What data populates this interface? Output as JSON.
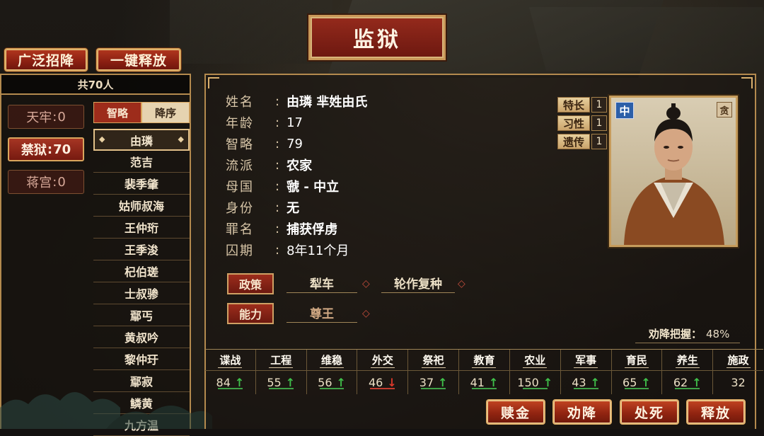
{
  "title": "监狱",
  "top_buttons": {
    "recruit_all": "广泛招降",
    "release_all": "一键释放"
  },
  "total_label": "共70人",
  "prisons": [
    {
      "label": "天牢",
      "count": "0"
    },
    {
      "label": "禁狱",
      "count": "70",
      "active": true
    },
    {
      "label": "蒋宫",
      "count": "0"
    }
  ],
  "sort": {
    "field": "智略",
    "order": "降序"
  },
  "prisoners": [
    "由璘",
    "范吉",
    "裴季肇",
    "姑师叔海",
    "王仲珩",
    "王季浚",
    "杞伯瑳",
    "士叔骖",
    "鄢丐",
    "黄叔吟",
    "黎仲玗",
    "鄢寂",
    "鳞黄",
    "九方温"
  ],
  "info": {
    "name_key": "姓名",
    "name_val": "由璘 芈姓由氏",
    "age_key": "年龄",
    "age_val": "17",
    "intel_key": "智略",
    "intel_val": "79",
    "school_key": "流派",
    "school_val": "农家",
    "home_key": "母国",
    "home_val": "虢 - 中立",
    "status_key": "身份",
    "status_val": "无",
    "crime_key": "罪名",
    "crime_val": "捕获俘虏",
    "term_key": "囚期",
    "term_val": "8年11个月"
  },
  "traits": [
    {
      "label": "特长",
      "value": "1"
    },
    {
      "label": "习性",
      "value": "1"
    },
    {
      "label": "遗传",
      "value": "1"
    }
  ],
  "portrait_badges": {
    "faction": "中",
    "trait": "贪"
  },
  "policy": {
    "label": "政策",
    "slot1": "犁车",
    "slot2": "轮作复种"
  },
  "ability": {
    "label": "能力",
    "slot1": "尊王"
  },
  "persuade": {
    "label": "劝降把握：",
    "value": "48%"
  },
  "skills": [
    {
      "name": "谍战",
      "value": "84",
      "trend": "up",
      "arrow": "↑"
    },
    {
      "name": "工程",
      "value": "55",
      "trend": "up",
      "arrow": "↑"
    },
    {
      "name": "维稳",
      "value": "56",
      "trend": "up",
      "arrow": "↑"
    },
    {
      "name": "外交",
      "value": "46",
      "trend": "down",
      "arrow": "↓"
    },
    {
      "name": "祭祀",
      "value": "37",
      "trend": "up",
      "arrow": "↑"
    },
    {
      "name": "教育",
      "value": "41",
      "trend": "up",
      "arrow": "↑"
    },
    {
      "name": "农业",
      "value": "150",
      "trend": "up",
      "arrow": "↑"
    },
    {
      "name": "军事",
      "value": "43",
      "trend": "up",
      "arrow": "↑"
    },
    {
      "name": "育民",
      "value": "65",
      "trend": "up",
      "arrow": "↑"
    },
    {
      "name": "养生",
      "value": "62",
      "trend": "up",
      "arrow": "↑"
    },
    {
      "name": "施政",
      "value": "32",
      "trend": "none",
      "arrow": ""
    }
  ],
  "actions": {
    "ransom": "赎金",
    "persuade": "劝降",
    "execute": "处死",
    "release": "释放"
  }
}
